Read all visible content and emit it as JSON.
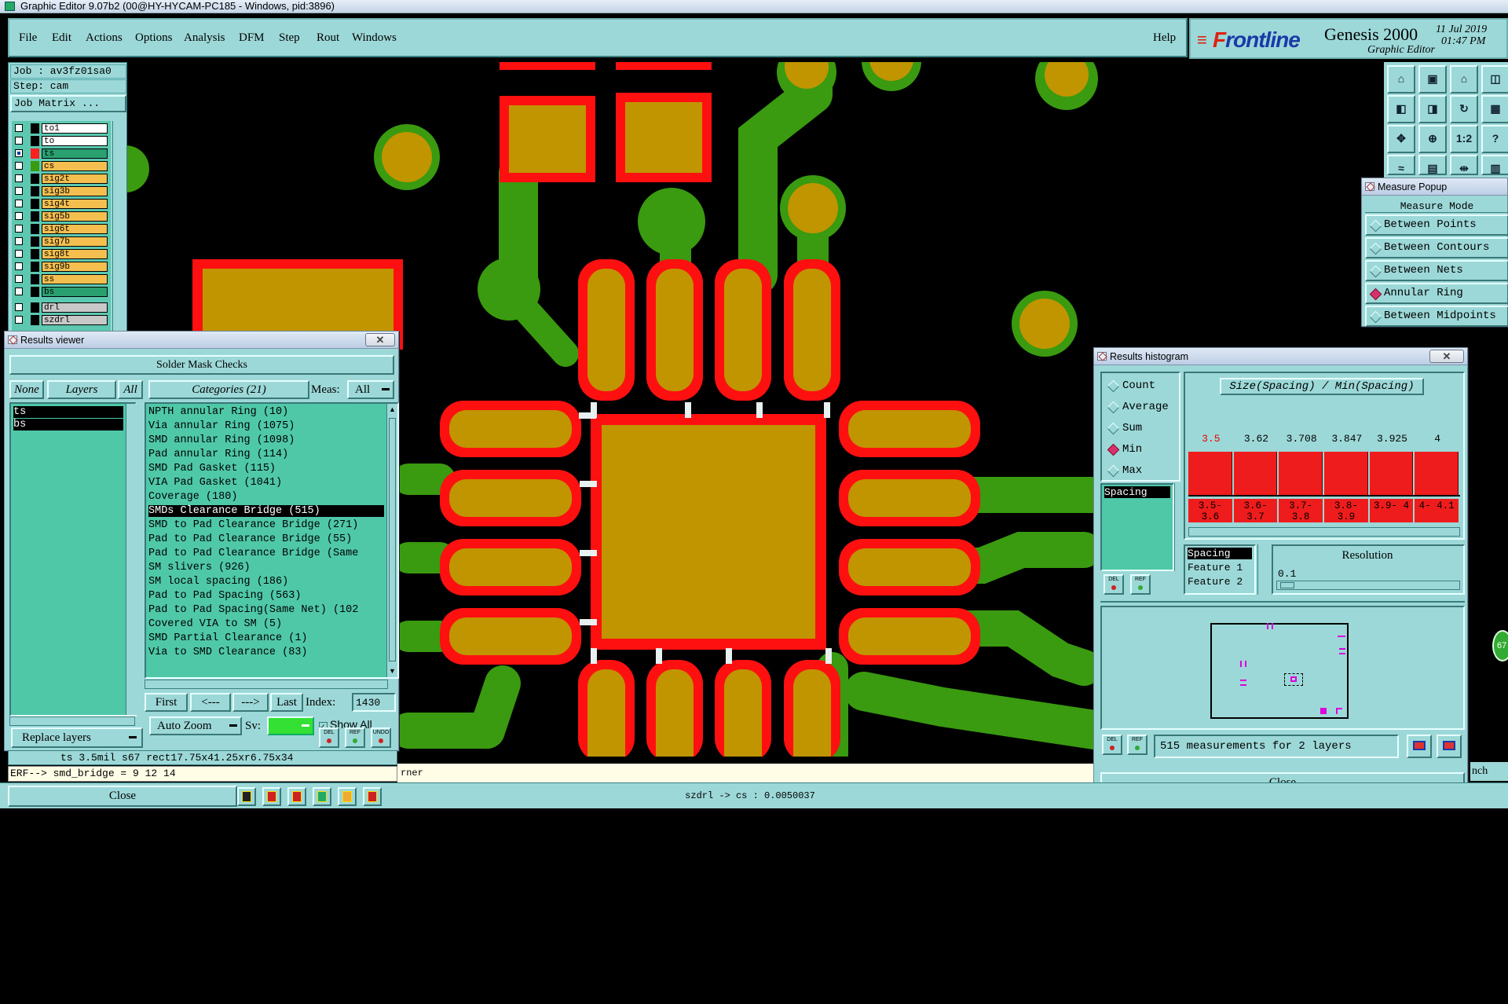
{
  "window": {
    "title": "Graphic Editor 9.07b2 (00@HY-HYCAM-PC185 - Windows, pid:3896)"
  },
  "menu": {
    "items": [
      "File",
      "Edit",
      "Actions",
      "Options",
      "Analysis",
      "DFM",
      "Step",
      "Rout",
      "Windows"
    ],
    "help": "Help"
  },
  "brand": {
    "logo_f": "F",
    "logo_rest": "rontline",
    "product": "Genesis 2000",
    "subtitle": "Graphic Editor",
    "date": "11 Jul 2019",
    "time": "01:47 PM"
  },
  "left_panel": {
    "job": "Job : av3fz01sa0",
    "step": "Step: cam",
    "job_matrix": "Job Matrix ...",
    "layers": [
      {
        "name": "to1",
        "color": "#ffffff",
        "swatch": "#000000",
        "checked": false
      },
      {
        "name": "to",
        "color": "#ffffff",
        "swatch": "#000000",
        "checked": false
      },
      {
        "name": "ts",
        "color": "#2aa070",
        "swatch": "#ff2020",
        "checked": true
      },
      {
        "name": "cs",
        "color": "#f5bf50",
        "swatch": "#3a9a10",
        "checked": false
      },
      {
        "name": "sig2t",
        "color": "#f5bf50",
        "swatch": "#000000",
        "checked": false
      },
      {
        "name": "sig3b",
        "color": "#f5bf50",
        "swatch": "#000000",
        "checked": false
      },
      {
        "name": "sig4t",
        "color": "#f5bf50",
        "swatch": "#000000",
        "checked": false
      },
      {
        "name": "sig5b",
        "color": "#f5bf50",
        "swatch": "#000000",
        "checked": false
      },
      {
        "name": "sig6t",
        "color": "#f5bf50",
        "swatch": "#000000",
        "checked": false
      },
      {
        "name": "sig7b",
        "color": "#f5bf50",
        "swatch": "#000000",
        "checked": false
      },
      {
        "name": "sig8t",
        "color": "#f5bf50",
        "swatch": "#000000",
        "checked": false
      },
      {
        "name": "sig9b",
        "color": "#f5bf50",
        "swatch": "#000000",
        "checked": false
      },
      {
        "name": "ss",
        "color": "#f5bf50",
        "swatch": "#000000",
        "checked": false
      },
      {
        "name": "bs",
        "color": "#2aa070",
        "swatch": "#000000",
        "checked": false
      },
      {
        "name": "drl",
        "color": "#c8c8c8",
        "swatch": "#000000",
        "checked": false
      },
      {
        "name": "szdrl",
        "color": "#c8c8c8",
        "swatch": "#000000",
        "checked": false
      }
    ]
  },
  "results_viewer": {
    "title": "Results viewer",
    "header": "Solder Mask Checks",
    "none_btn": "None",
    "layers_btn": "Layers",
    "all_btn": "All",
    "categories_btn": "Categories (21)",
    "meas_label": "Meas:",
    "meas_value": "All",
    "layers": [
      "ts",
      "bs"
    ],
    "categories": [
      "NPTH annular Ring (10)",
      "Via annular Ring (1075)",
      "SMD annular Ring (1098)",
      "Pad annular Ring (114)",
      "SMD Pad Gasket (115)",
      "VIA Pad Gasket (1041)",
      "Coverage (180)",
      "SMDs Clearance Bridge (515)",
      "SMD to Pad Clearance Bridge (271)",
      "Pad to Pad Clearance Bridge (55)",
      "Pad to Pad Clearance Bridge (Same",
      "SM slivers (926)",
      "SM local spacing (186)",
      "Pad to Pad Spacing (563)",
      "Pad to Pad Spacing(Same Net) (102",
      "Covered VIA to SM (5)",
      "SMD Partial Clearance (1)",
      "Via to SMD Clearance (83)"
    ],
    "selected_index": 7,
    "first_btn": "First",
    "prev_btn": "<---",
    "next_btn": "--->",
    "last_btn": "Last",
    "index_label": "Index:",
    "index_value": "1430",
    "auto_zoom": "Auto Zoom",
    "sv_label": "Sv:",
    "show_all": "Show All",
    "replace_layers": "Replace layers",
    "del": "DEL",
    "ref": "REF",
    "undo": "UNDO"
  },
  "status": {
    "line": "ts 3.5mil  s67  rect17.75x41.25xr6.75x34",
    "erf": "ERF--> smd_bridge = 9 12 14",
    "hint": "rner",
    "close": "Close",
    "coords": "szdrl -> cs : 0.0050037"
  },
  "measure_popup": {
    "title": "Measure Popup",
    "mode_label": "Measure Mode",
    "options": [
      "Between Points",
      "Between Contours",
      "Between Nets",
      "Annular Ring",
      "Between Midpoints"
    ],
    "selected": 3
  },
  "histogram": {
    "title": "Results histogram",
    "stat_options": [
      "Count",
      "Average",
      "Sum",
      "Min",
      "Max"
    ],
    "stat_selected": 3,
    "attr_list": [
      "Spacing"
    ],
    "chart_title": "Size(Spacing) / Min(Spacing)",
    "bars": [
      {
        "value": "3.5",
        "range": "3.5- 3.6",
        "highlight": true
      },
      {
        "value": "3.62",
        "range": "3.6- 3.7",
        "highlight": false
      },
      {
        "value": "3.708",
        "range": "3.7- 3.8",
        "highlight": false
      },
      {
        "value": "3.847",
        "range": "3.8- 3.9",
        "highlight": false
      },
      {
        "value": "3.925",
        "range": "3.9- 4",
        "highlight": false
      },
      {
        "value": "4",
        "range": "4- 4.1",
        "highlight": false
      }
    ],
    "fields": [
      "Spacing",
      "Feature 1",
      "Feature 2"
    ],
    "resolution_label": "Resolution",
    "resolution_value": "0.1",
    "summary": "515 measurements for 2 layers",
    "close": "Close",
    "del": "DEL",
    "ref": "REF"
  },
  "right_toolbar": {
    "btn_ratio": "1:2",
    "btn_help": "?"
  },
  "edge_text": {
    "side": "nch",
    "circle": "67"
  },
  "colors": {
    "panel": "#9dd8d8",
    "list": "#4fc8a8",
    "pcb_red": "#ff1010",
    "pcb_copper": "#c09500",
    "pcb_green": "#3a9a10"
  }
}
